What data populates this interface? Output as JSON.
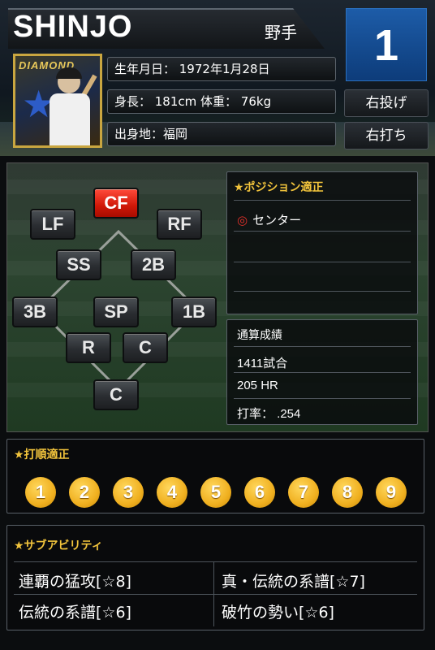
{
  "player": {
    "name": "SHINJO",
    "role": "野手",
    "uniform_number": "1",
    "throws": "右投げ",
    "bats": "右打ち",
    "birth": "生年月日： 1972年1月28日",
    "body": "身長： 181cm 体重： 76kg",
    "origin": "出身地：福岡",
    "card_label": "DIAMOND"
  },
  "positions": {
    "cf": "CF",
    "lf": "LF",
    "rf": "RF",
    "ss": "SS",
    "second": "2B",
    "third": "3B",
    "sp": "SP",
    "first": "1B",
    "rp": "R",
    "closer": "C",
    "catcher": "C",
    "active": "CF",
    "active_color": "#e0200f"
  },
  "position_aptitude": {
    "title": "★ポジション適正",
    "mark": "◎",
    "entry": "センター"
  },
  "career_stats": {
    "title": "通算成績",
    "games": "1411試合",
    "home_runs": "205 HR",
    "average": "打率：  .254"
  },
  "batting_order": {
    "title": "★打順適正",
    "slots": [
      "1",
      "2",
      "3",
      "4",
      "5",
      "6",
      "7",
      "8",
      "9"
    ]
  },
  "sub_abilities": {
    "title": "★サブアビリティ",
    "items": [
      "連覇の猛攻[☆8]",
      "真・伝統の系譜[☆7]",
      "伝統の系譜[☆6]",
      "破竹の勢い[☆6]"
    ]
  },
  "colors": {
    "accent_gold": "#f2c43c",
    "number_blue": "#1d5ca8",
    "order_gold": "#f0b020"
  }
}
